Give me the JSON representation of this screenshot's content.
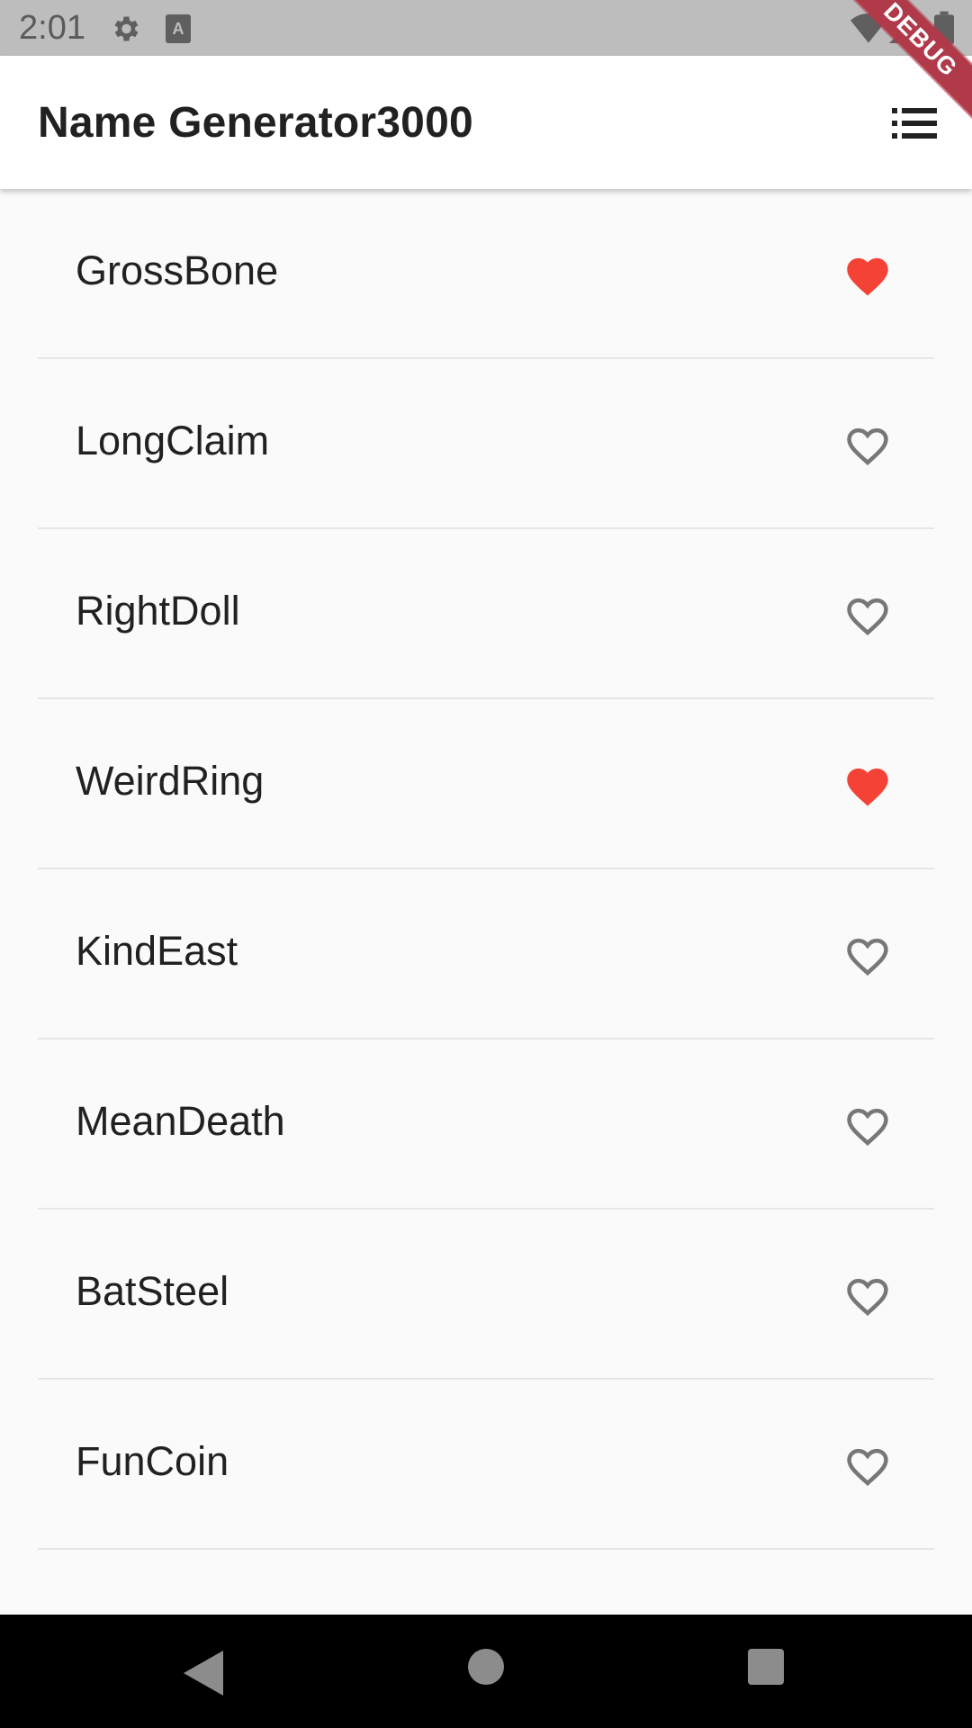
{
  "status_bar": {
    "time": "2:01",
    "icons": [
      "gear-icon",
      "keyboard-a-icon",
      "wifi-icon",
      "signal-icon",
      "battery-icon"
    ]
  },
  "debug_banner": "DEBUG",
  "app_bar": {
    "title": "Name Generator3000",
    "action_icon": "list-icon"
  },
  "colors": {
    "favorite": "#f44336",
    "unfavorite": "#777777"
  },
  "items": [
    {
      "label": "GrossBone",
      "favorited": true
    },
    {
      "label": "LongClaim",
      "favorited": false
    },
    {
      "label": "RightDoll",
      "favorited": false
    },
    {
      "label": "WeirdRing",
      "favorited": true
    },
    {
      "label": "KindEast",
      "favorited": false
    },
    {
      "label": "MeanDeath",
      "favorited": false
    },
    {
      "label": "BatSteel",
      "favorited": false
    },
    {
      "label": "FunCoin",
      "favorited": false
    }
  ],
  "nav_bar": {
    "icons": [
      "back-icon",
      "home-icon",
      "recents-icon"
    ]
  }
}
